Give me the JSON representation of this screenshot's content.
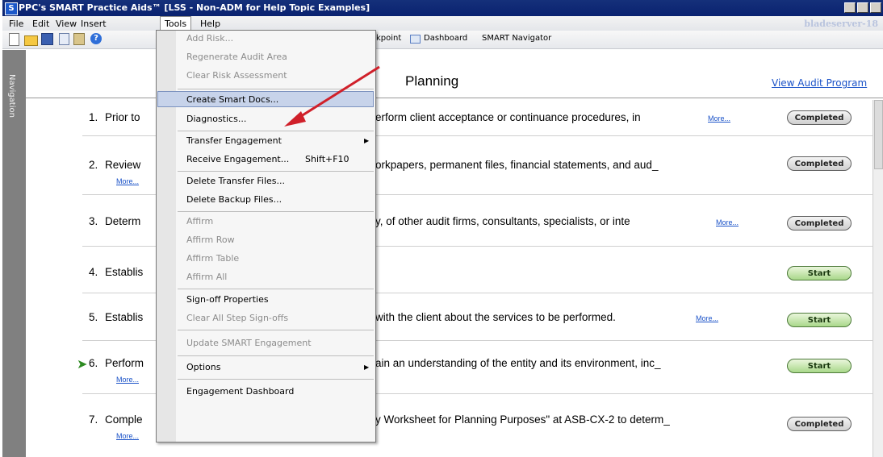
{
  "window": {
    "title": "PPC's SMART Practice Aids™ [LSS - Non-ADM for Help Topic Examples]",
    "app_icon_letter": "S",
    "server": "bladeserver-18"
  },
  "menubar": {
    "items": [
      "File",
      "Edit",
      "View",
      "Insert",
      "Tools",
      "Help"
    ],
    "open_item": "Tools"
  },
  "toolbar": {
    "checkpoint_text": "kpoint",
    "dashboard_label": "Dashboard",
    "navigator_label": "SMART Navigator"
  },
  "navigation": {
    "label": "Navigation"
  },
  "page": {
    "heading": "Planning",
    "view_audit_link": "View Audit Program"
  },
  "steps": [
    {
      "num": "1.",
      "lhs": "Prior  to",
      "rhs": "erform  client  acceptance  or  continuance  procedures,  in",
      "more": "More...",
      "status": "Completed",
      "status_type": "completed"
    },
    {
      "num": "2.",
      "lhs": "Review",
      "rhs": "orkpapers,  permanent  files,  financial  statements,  and  aud_",
      "more": "More...",
      "status": "Completed",
      "status_type": "completed"
    },
    {
      "num": "3.",
      "lhs": "Determ",
      "rhs": "y,  of  other  audit  firms,  consultants,  specialists,  or  inte",
      "more": "More...",
      "status": "Completed",
      "status_type": "completed"
    },
    {
      "num": "4.",
      "lhs": "Establis",
      "rhs": "",
      "more": "",
      "status": "Start",
      "status_type": "start"
    },
    {
      "num": "5.",
      "lhs": "Establis",
      "rhs": "with  the  client  about  the  services  to  be  performed.",
      "more": "More...",
      "status": "Start",
      "status_type": "start"
    },
    {
      "num": "6.",
      "lhs": "Perform",
      "rhs": "ain  an  understanding  of  the  entity  and  its  environment,  inc_",
      "more": "More...",
      "status": "Start",
      "status_type": "start"
    },
    {
      "num": "7.",
      "lhs": "Comple",
      "rhs": "y  Worksheet  for  Planning  Purposes\"  at  ASB-CX-2  to  determ_",
      "more": "More...",
      "status": "Completed",
      "status_type": "completed"
    }
  ],
  "tools_menu": {
    "add_risk": "Add Risk...",
    "regenerate": "Regenerate Audit Area",
    "clear_risk": "Clear Risk Assessment",
    "create_smart_docs": "Create Smart Docs...",
    "diagnostics": "Diagnostics...",
    "transfer_engagement": "Transfer Engagement",
    "receive_engagement": "Receive Engagement...",
    "receive_shortcut": "Shift+F10",
    "delete_transfer": "Delete Transfer Files...",
    "delete_backup": "Delete Backup Files...",
    "affirm": "Affirm",
    "affirm_row": "Affirm Row",
    "affirm_table": "Affirm Table",
    "affirm_all": "Affirm All",
    "signoff_props": "Sign-off Properties",
    "clear_signoffs": "Clear All Step Sign-offs",
    "update_smart": "Update SMART Engagement",
    "options": "Options",
    "engagement_dashboard": "Engagement Dashboard"
  },
  "colors": {
    "titlebar": "#0a2270",
    "link": "#1a52c8",
    "highlight": "#c7d3ea",
    "annotation_arrow": "#d0202a"
  }
}
